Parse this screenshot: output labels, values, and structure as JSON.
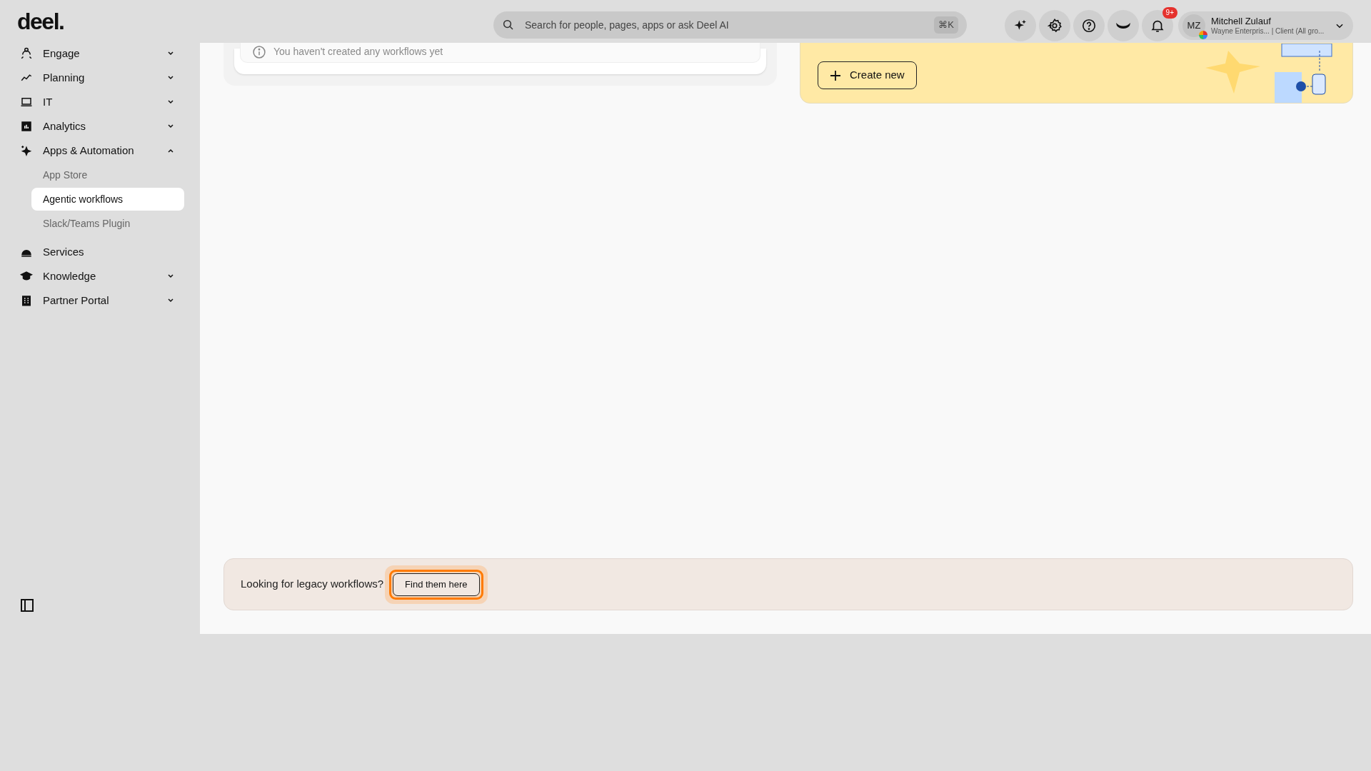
{
  "logo": "deel.",
  "search": {
    "placeholder": "Search for people, pages, apps or ask Deel AI",
    "shortcut": "⌘K"
  },
  "notifications": {
    "badge": "9+"
  },
  "profile": {
    "initials": "MZ",
    "name": "Mitchell Zulauf",
    "subtitle": "Wayne Enterpris... | Client (All gro..."
  },
  "sidebar": {
    "items": [
      {
        "label": "Engage",
        "expanded": false
      },
      {
        "label": "Planning",
        "expanded": false
      },
      {
        "label": "IT",
        "expanded": false
      },
      {
        "label": "Analytics",
        "expanded": false
      },
      {
        "label": "Apps & Automation",
        "expanded": true,
        "children": [
          {
            "label": "App Store",
            "selected": false
          },
          {
            "label": "Agentic workflows",
            "selected": true
          },
          {
            "label": "Slack/Teams Plugin",
            "selected": false
          }
        ]
      },
      {
        "label": "Services"
      },
      {
        "label": "Knowledge",
        "expanded": false
      },
      {
        "label": "Partner Portal",
        "expanded": false
      }
    ]
  },
  "workflows_card": {
    "empty_message": "You haven't created any workflows yet"
  },
  "template_banner": {
    "button": "Create new"
  },
  "legacy_bar": {
    "text": "Looking for legacy workflows?",
    "button": "Find them here"
  }
}
